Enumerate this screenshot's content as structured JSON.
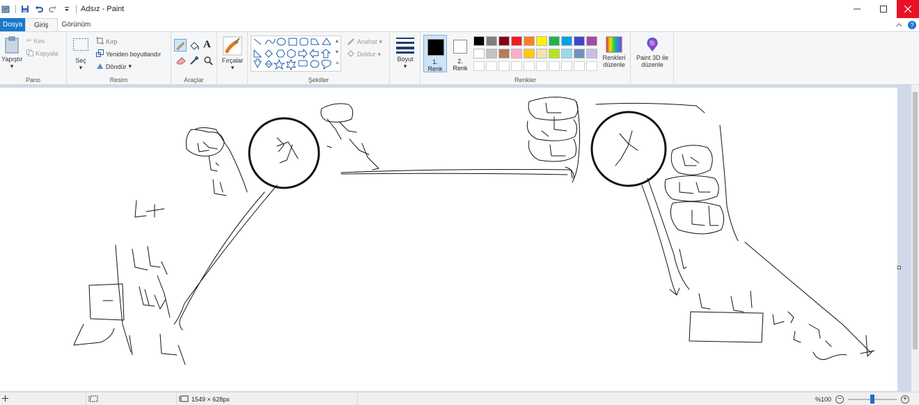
{
  "window": {
    "title": "Adsız - Paint"
  },
  "tabs": {
    "file": "Dosya",
    "home": "Giriş",
    "view": "Görünüm"
  },
  "clipboard": {
    "paste": "Yapıştır",
    "cut": "Kes",
    "copy": "Kopyala",
    "label": "Pano"
  },
  "image": {
    "select": "Seç",
    "crop": "Kırp",
    "resize": "Yeniden boyutlandır",
    "rotate": "Döndür",
    "label": "Resim"
  },
  "tools": {
    "text_glyph": "A",
    "label": "Araçlar"
  },
  "brushes": {
    "label": "Fırçalar"
  },
  "shapes": {
    "outline": "Anahat",
    "fill": "Doldur",
    "label": "Şekiller"
  },
  "size": {
    "label": "Boyut"
  },
  "colors": {
    "color1_num": "1.",
    "color1_word": "Renk",
    "color2_num": "2.",
    "color2_word": "Renk",
    "edit_line1": "Renkleri",
    "edit_line2": "düzenle",
    "label": "Renkler",
    "color1_value": "#000000",
    "color2_value": "#ffffff",
    "palette": [
      "#000000",
      "#7f7f7f",
      "#880015",
      "#ed1c24",
      "#ff7f27",
      "#fff200",
      "#22b14c",
      "#00a2e8",
      "#3f48cc",
      "#a349a4",
      "#ffffff",
      "#c3c3c3",
      "#b97a57",
      "#ffaec9",
      "#ffc90e",
      "#efe4b0",
      "#b5e61d",
      "#99d9ea",
      "#7092be",
      "#c8bfe7"
    ]
  },
  "paint3d": {
    "line1": "Paint 3D ile",
    "line2": "düzenle"
  },
  "statusbar": {
    "dimensions": "1549 × 628px",
    "zoom": "%100"
  }
}
